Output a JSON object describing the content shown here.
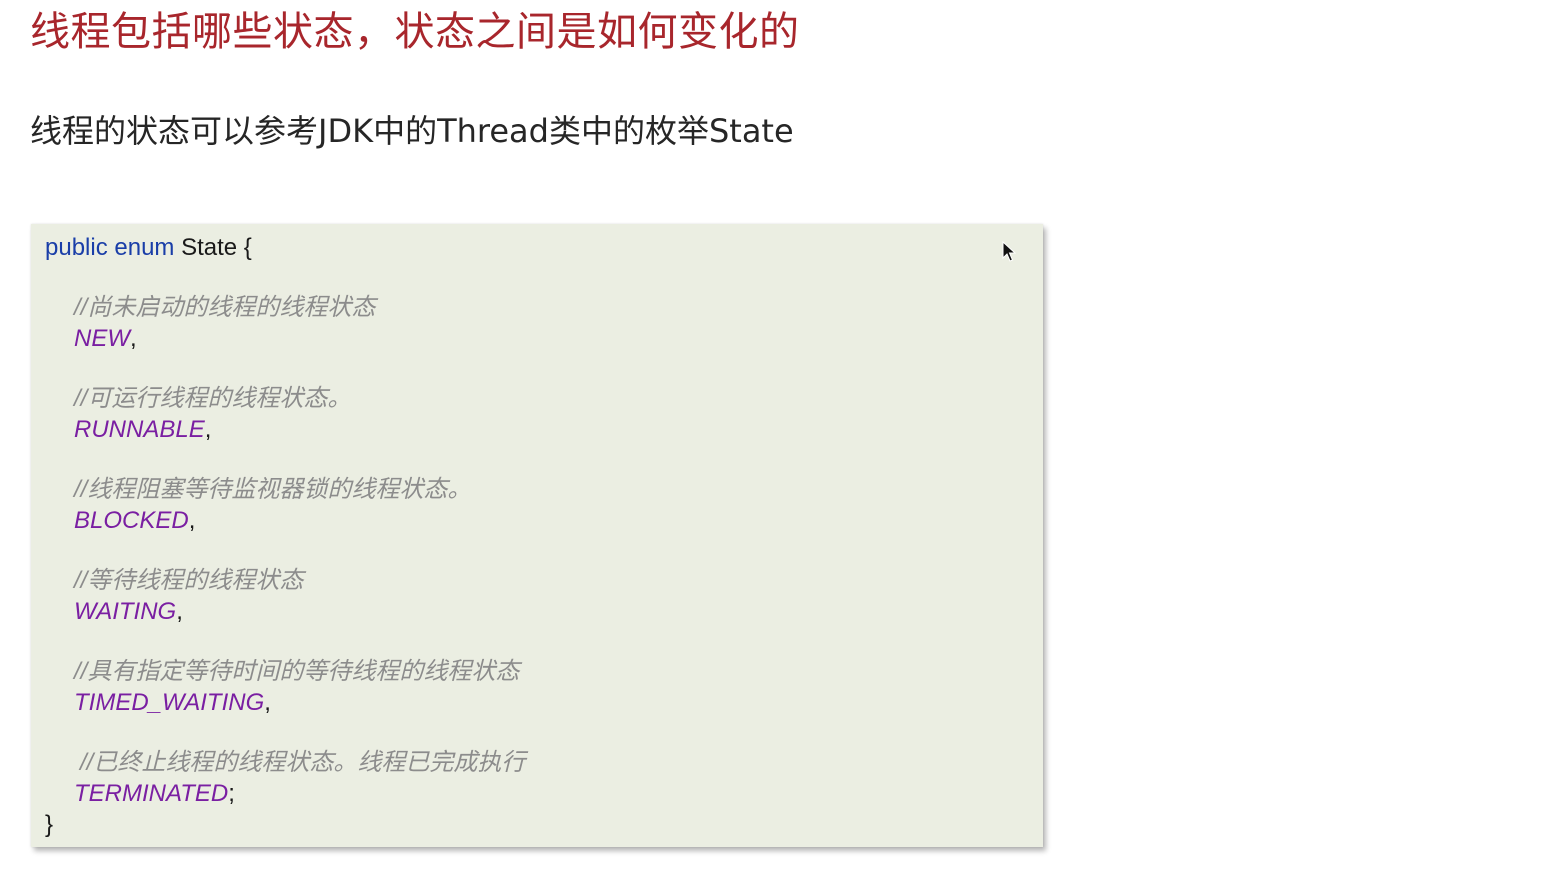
{
  "title": "线程包括哪些状态，状态之间是如何变化的",
  "subtitle": "线程的状态可以参考JDK中的Thread类中的枚举State",
  "code": {
    "keywords": "public enum",
    "class_name": "State {",
    "closing_brace": "}",
    "entries": [
      {
        "comment": "//尚未启动的线程的线程状态",
        "constant": "NEW",
        "separator": ","
      },
      {
        "comment": "//可运行线程的线程状态。",
        "constant": "RUNNABLE",
        "separator": ","
      },
      {
        "comment": "//线程阻塞等待监视器锁的线程状态。",
        "constant": "BLOCKED",
        "separator": ","
      },
      {
        "comment": "//等待线程的线程状态",
        "constant": "WAITING",
        "separator": ","
      },
      {
        "comment": "//具有指定等待时间的等待线程的线程状态",
        "constant": "TIMED_WAITING",
        "separator": ","
      },
      {
        "comment": "//已终止线程的线程状态。线程已完成执行",
        "constant": "TERMINATED",
        "separator": ";"
      }
    ]
  },
  "colors": {
    "title": "#a8262c",
    "keyword": "#1a3ea8",
    "comment": "#8c8c8c",
    "constant": "#7a1fa2",
    "code_background": "#ebeee2"
  },
  "icons": {
    "cursor": "mouse-pointer-icon"
  }
}
